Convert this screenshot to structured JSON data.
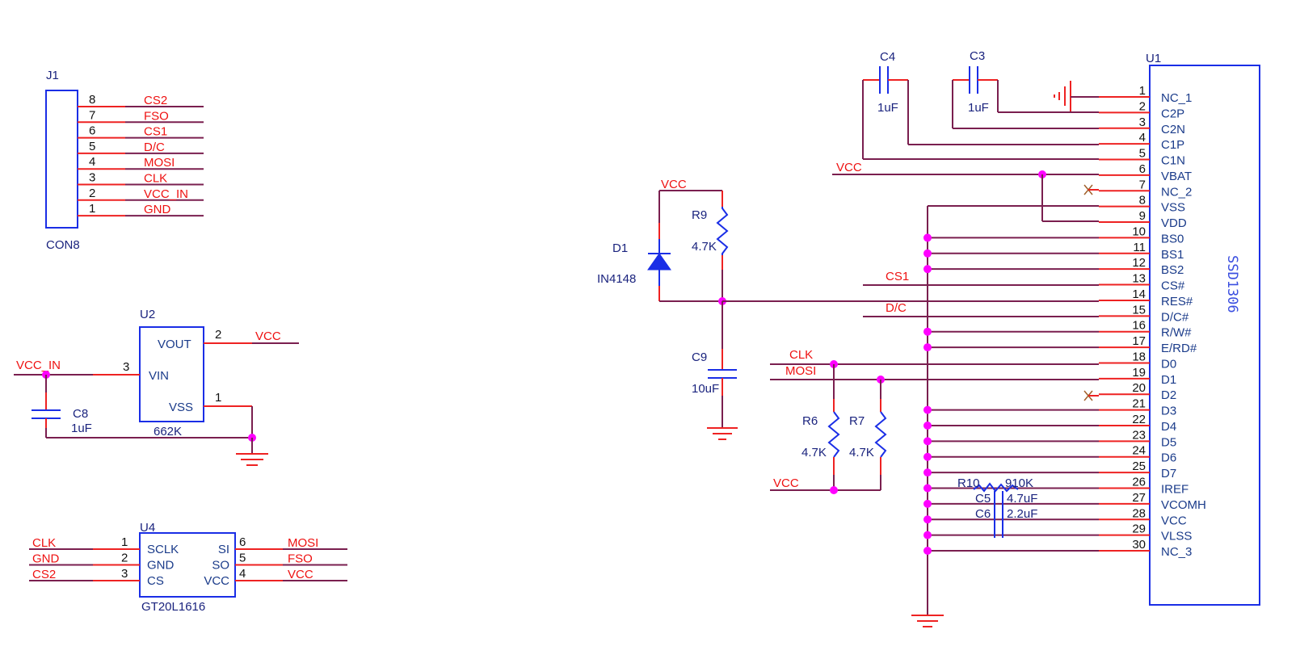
{
  "j1": {
    "ref": "J1",
    "value": "CON8",
    "pins": [
      {
        "num": "8",
        "net": "CS2"
      },
      {
        "num": "7",
        "net": "FSO"
      },
      {
        "num": "6",
        "net": "CS1"
      },
      {
        "num": "5",
        "net": "D/C"
      },
      {
        "num": "4",
        "net": "MOSI"
      },
      {
        "num": "3",
        "net": "CLK"
      },
      {
        "num": "2",
        "net": "VCC_IN"
      },
      {
        "num": "1",
        "net": "GND"
      }
    ]
  },
  "u2": {
    "ref": "U2",
    "value": "662K",
    "pins": [
      {
        "num": "2",
        "name": "VOUT",
        "net": "VCC"
      },
      {
        "num": "3",
        "name": "VIN",
        "net": "VCC_IN"
      },
      {
        "num": "1",
        "name": "VSS",
        "net": ""
      }
    ],
    "c8": {
      "ref": "C8",
      "value": "1uF"
    }
  },
  "u4": {
    "ref": "U4",
    "value": "GT20L1616",
    "left_pins": [
      {
        "num": "1",
        "name": "SCLK",
        "net": "CLK"
      },
      {
        "num": "2",
        "name": "GND",
        "net": "GND"
      },
      {
        "num": "3",
        "name": "CS",
        "net": "CS2"
      }
    ],
    "right_pins": [
      {
        "num": "6",
        "name": "SI",
        "net": "MOSI"
      },
      {
        "num": "5",
        "name": "SO",
        "net": "FSO"
      },
      {
        "num": "4",
        "name": "VCC",
        "net": "VCC"
      }
    ]
  },
  "reset_circuit": {
    "net_vcc": "VCC",
    "d1": {
      "ref": "D1",
      "value": "IN4148"
    },
    "r9": {
      "ref": "R9",
      "value": "4.7K"
    },
    "c9": {
      "ref": "C9",
      "value": "10uF"
    }
  },
  "pullups": {
    "net_clk": "CLK",
    "net_mosi": "MOSI",
    "net_vcc": "VCC",
    "r6": {
      "ref": "R6",
      "value": "4.7K"
    },
    "r7": {
      "ref": "R7",
      "value": "4.7K"
    }
  },
  "charge_pump": {
    "c4": {
      "ref": "C4",
      "value": "1uF"
    },
    "c3": {
      "ref": "C3",
      "value": "1uF"
    },
    "net_vcc": "VCC"
  },
  "u1_nets": {
    "cs1": "CS1",
    "dc": "D/C"
  },
  "iref": {
    "r10": {
      "ref": "R10",
      "value": "910K"
    },
    "c5": {
      "ref": "C5",
      "value": "4.7uF"
    },
    "c6": {
      "ref": "C6",
      "value": "2.2uF"
    }
  },
  "u1": {
    "ref": "U1",
    "value": "SSD1306",
    "pins": [
      {
        "num": "1",
        "name": "NC_1"
      },
      {
        "num": "2",
        "name": "C2P"
      },
      {
        "num": "3",
        "name": "C2N"
      },
      {
        "num": "4",
        "name": "C1P"
      },
      {
        "num": "5",
        "name": "C1N"
      },
      {
        "num": "6",
        "name": "VBAT"
      },
      {
        "num": "7",
        "name": "NC_2"
      },
      {
        "num": "8",
        "name": "VSS"
      },
      {
        "num": "9",
        "name": "VDD"
      },
      {
        "num": "10",
        "name": "BS0"
      },
      {
        "num": "11",
        "name": "BS1"
      },
      {
        "num": "12",
        "name": "BS2"
      },
      {
        "num": "13",
        "name": "CS#"
      },
      {
        "num": "14",
        "name": "RES#"
      },
      {
        "num": "15",
        "name": "D/C#"
      },
      {
        "num": "16",
        "name": "R/W#"
      },
      {
        "num": "17",
        "name": "E/RD#"
      },
      {
        "num": "18",
        "name": "D0"
      },
      {
        "num": "19",
        "name": "D1"
      },
      {
        "num": "20",
        "name": "D2"
      },
      {
        "num": "21",
        "name": "D3"
      },
      {
        "num": "22",
        "name": "D4"
      },
      {
        "num": "23",
        "name": "D5"
      },
      {
        "num": "24",
        "name": "D6"
      },
      {
        "num": "25",
        "name": "D7"
      },
      {
        "num": "26",
        "name": "IREF"
      },
      {
        "num": "27",
        "name": "VCOMH"
      },
      {
        "num": "28",
        "name": "VCC"
      },
      {
        "num": "29",
        "name": "VLSS"
      },
      {
        "num": "30",
        "name": "NC_3"
      }
    ]
  }
}
